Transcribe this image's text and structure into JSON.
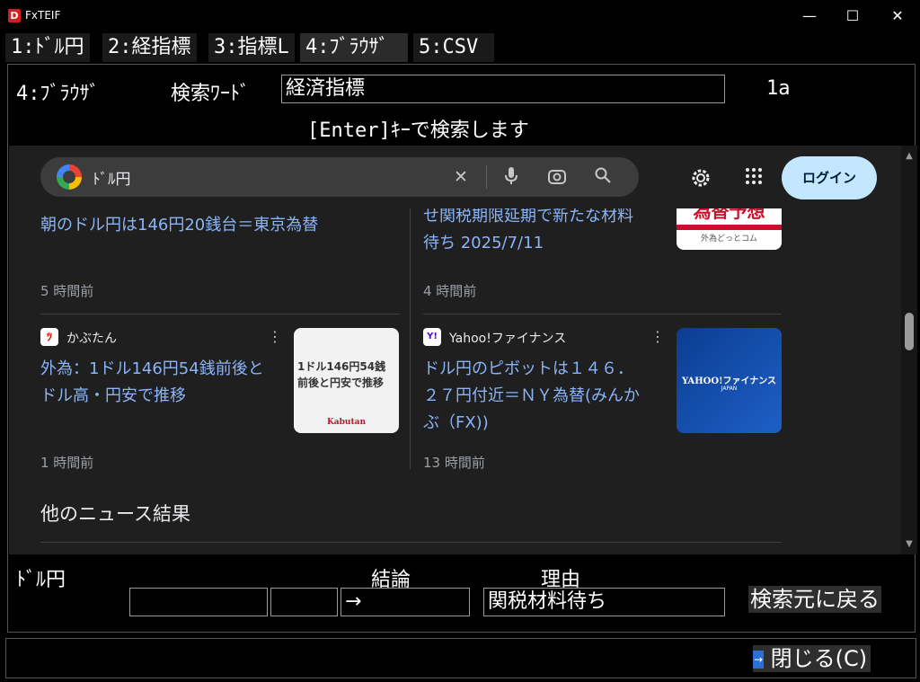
{
  "window": {
    "logo_letter": "D",
    "title": "FxTEIF",
    "minimize": "—",
    "maximize": "☐",
    "close": "✕"
  },
  "tabs": [
    {
      "label": "1:ﾄﾞﾙ円",
      "active": false
    },
    {
      "label": "2:経指標",
      "active": false
    },
    {
      "label": "3:指標L",
      "active": false
    },
    {
      "label": "4:ﾌﾞﾗｳｻﾞ",
      "active": true
    },
    {
      "label": "5:CSV",
      "active": false
    }
  ],
  "panel": {
    "heading": "4:ﾌﾞﾗｳｻﾞ",
    "search_label": "検索ﾜｰﾄﾞ",
    "search_value": "経済指標",
    "code": "1a",
    "hint": "[Enter]ｷｰで検索します"
  },
  "browser": {
    "query": "ﾄﾞﾙ円",
    "login": "ログイン",
    "news": [
      {
        "headline_lines": [
          "朝のドル円は146円20銭台＝東京為替"
        ],
        "time": "5 時間前"
      },
      {
        "headline_lines": [
          "せ関税期限延期で新たな材料",
          "待ち 2025/7/11"
        ],
        "time": "4 時間前",
        "thumb_text": "為替予想",
        "thumb_sub": "外為どっとコム"
      },
      {
        "source": "かぶたん",
        "headline_lines": [
          "外為：1ドル146円54銭前後と",
          "ドル高・円安で推移"
        ],
        "time": "1 時間前",
        "thumb_text": "1ドル146円54銭前後と円安で推移",
        "thumb_sub": "Kabutan"
      },
      {
        "source": "Yahoo!ファイナンス",
        "headline_lines": [
          "ドル円のピボットは１４６．",
          "２７円付近＝ＮＹ為替(みんか",
          "ぶ（FX))"
        ],
        "time": "13 時間前",
        "thumb_text": "YAHOO!ファイナンス",
        "thumb_sub": "JAPAN"
      }
    ],
    "more_news": "他のニュース結果"
  },
  "bottom": {
    "pair": "ﾄﾞﾙ円",
    "conclusion_label": "結論",
    "reason_label": "理由",
    "field1": "",
    "field2": "",
    "arrow_value": "→",
    "reason_value": "関税材料待ち",
    "back_button": "検索元に戻る",
    "close_button": "閉じる(C)"
  },
  "colors": {
    "link": "#8ab4f8",
    "login_bg": "#c2e7ff",
    "browser_bg": "#1f1f1f"
  }
}
